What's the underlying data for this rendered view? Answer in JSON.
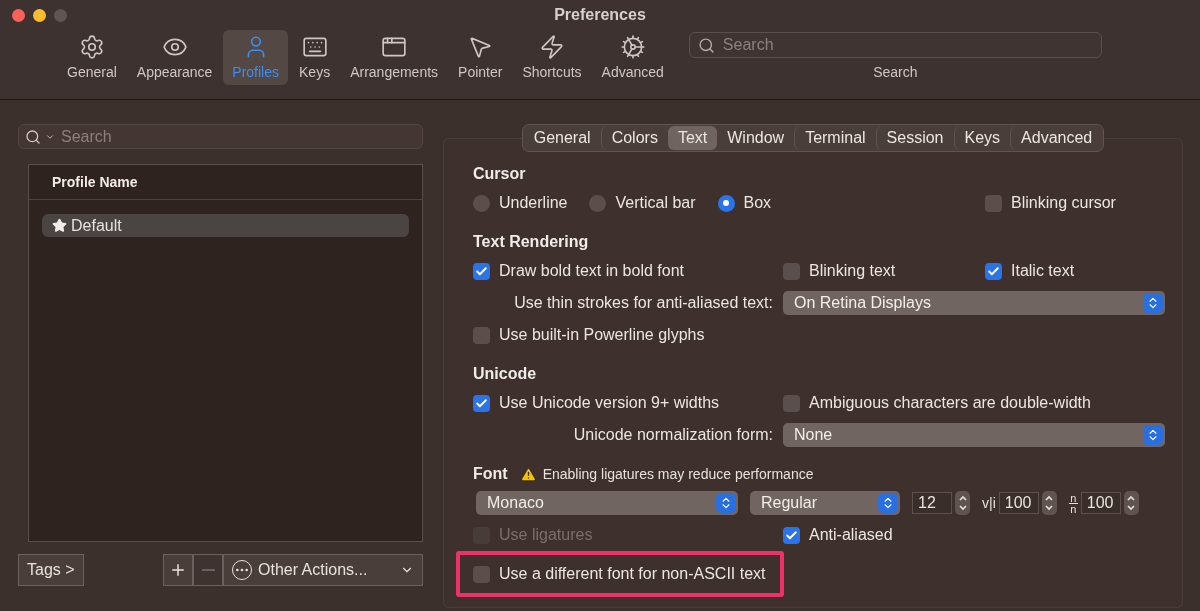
{
  "window": {
    "title": "Preferences"
  },
  "toolbar": {
    "items": [
      {
        "label": "General",
        "selected": false
      },
      {
        "label": "Appearance",
        "selected": false
      },
      {
        "label": "Profiles",
        "selected": true
      },
      {
        "label": "Keys",
        "selected": false
      },
      {
        "label": "Arrangements",
        "selected": false
      },
      {
        "label": "Pointer",
        "selected": false
      },
      {
        "label": "Shortcuts",
        "selected": false
      },
      {
        "label": "Advanced",
        "selected": false
      }
    ],
    "search": {
      "placeholder": "Search",
      "label": "Search"
    }
  },
  "profiles": {
    "search": {
      "placeholder": "Search"
    },
    "column": "Profile Name",
    "rows": [
      {
        "name": "Default",
        "default": true,
        "selected": true
      }
    ],
    "tags_button": "Tags >",
    "buttons": [
      {
        "kind": "add",
        "disabled": false
      },
      {
        "kind": "remove",
        "disabled": true
      }
    ],
    "actions_menu": "Other Actions..."
  },
  "tabs": [
    {
      "label": "General",
      "selected": false
    },
    {
      "label": "Colors",
      "selected": false
    },
    {
      "label": "Text",
      "selected": true
    },
    {
      "label": "Window",
      "selected": false
    },
    {
      "label": "Terminal",
      "selected": false
    },
    {
      "label": "Session",
      "selected": false
    },
    {
      "label": "Keys",
      "selected": false
    },
    {
      "label": "Advanced",
      "selected": false
    }
  ],
  "sections": [
    {
      "title": "Cursor",
      "rows": [
        [
          {
            "kind": "radio-group",
            "options": [
              {
                "label": "Underline",
                "selected": false
              },
              {
                "label": "Vertical bar",
                "selected": false
              },
              {
                "label": "Box",
                "selected": true
              }
            ]
          },
          {
            "kind": "checkbox",
            "label": "Blinking cursor",
            "checked": false,
            "disabled": false
          }
        ]
      ]
    },
    {
      "title": "Text Rendering",
      "rows": [
        [
          {
            "kind": "checkbox",
            "label": "Draw bold text in bold font",
            "checked": true,
            "disabled": false
          },
          {
            "kind": "checkbox",
            "label": "Blinking text",
            "checked": false,
            "disabled": false
          },
          {
            "kind": "checkbox",
            "label": "Italic text",
            "checked": true,
            "disabled": false
          }
        ],
        [
          {
            "kind": "select",
            "label": "Use thin strokes for anti-aliased text:",
            "value": "On Retina Displays"
          }
        ],
        [
          {
            "kind": "checkbox",
            "label": "Use built-in Powerline glyphs",
            "checked": false,
            "disabled": false
          }
        ]
      ]
    },
    {
      "title": "Unicode",
      "rows": [
        [
          {
            "kind": "checkbox",
            "label": "Use Unicode version 9+ widths",
            "checked": true,
            "disabled": false
          },
          {
            "kind": "checkbox",
            "label": "Ambiguous characters are double-width",
            "checked": false,
            "disabled": false
          }
        ],
        [
          {
            "kind": "select",
            "label": "Unicode normalization form:",
            "value": "None"
          }
        ]
      ]
    },
    {
      "title": "Font",
      "warning": "Enabling ligatures may reduce performance",
      "rows": [
        [
          {
            "kind": "font",
            "font": "Monaco",
            "weight": "Regular",
            "size": "12",
            "steppers": [
              {
                "label": "v|i",
                "value": "100"
              },
              {
                "label_top": "n",
                "label_bottom": "n",
                "value": "100"
              }
            ]
          }
        ],
        [
          {
            "kind": "checkbox",
            "label": "Use ligatures",
            "checked": false,
            "disabled": true
          },
          {
            "kind": "checkbox",
            "label": "Anti-aliased",
            "checked": true,
            "disabled": false
          }
        ],
        [
          {
            "kind": "checkbox",
            "label": "Use a different font for non-ASCII text",
            "checked": false,
            "disabled": false,
            "highlighted": true
          }
        ]
      ]
    }
  ]
}
